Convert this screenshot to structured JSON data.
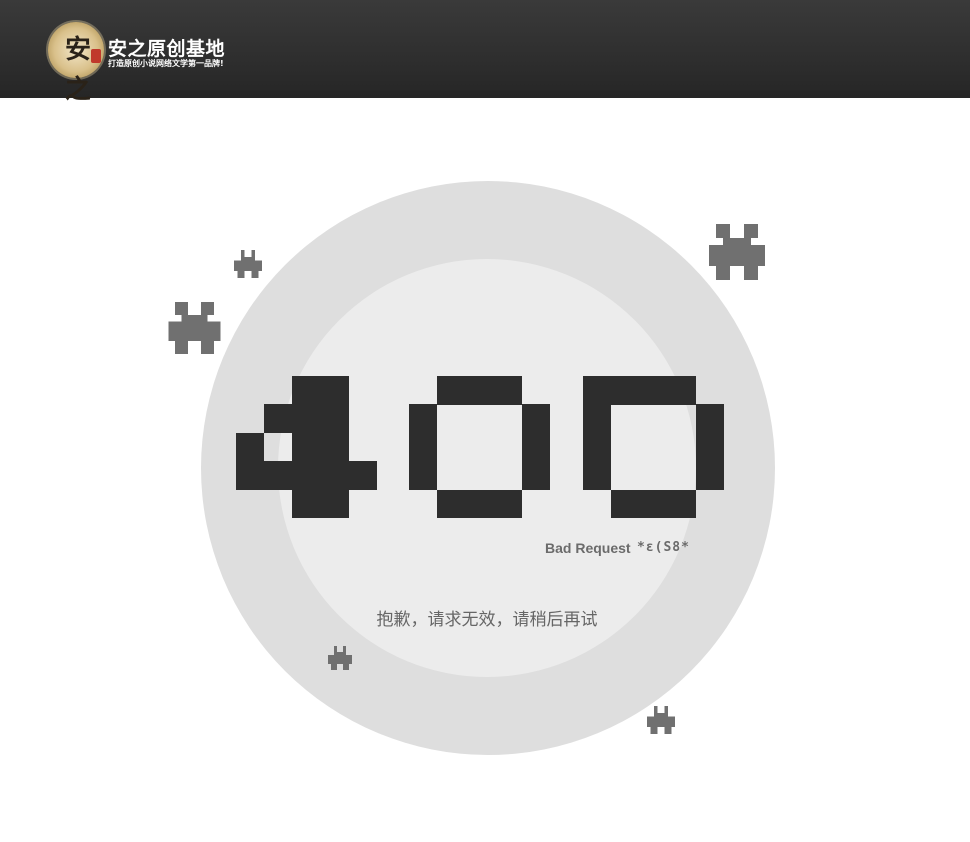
{
  "header": {
    "logo_glyph": "安之",
    "site_name": "安之原创基地",
    "slogan": "打造原创小说网络文学第一品牌!"
  },
  "error": {
    "code": "400",
    "status_text": "Bad Request",
    "status_glyphs": "*ε(S8*",
    "message": "抱歉，请求无效，请稍后再试"
  },
  "colors": {
    "header_bg": "#2f2f2f",
    "outer_circle": "#dedede",
    "inner_circle": "#ececec",
    "digits": "#2d2d2d",
    "invaders": "#707070",
    "text_gray": "#666666"
  },
  "icons": [
    "space-invader-icon"
  ]
}
